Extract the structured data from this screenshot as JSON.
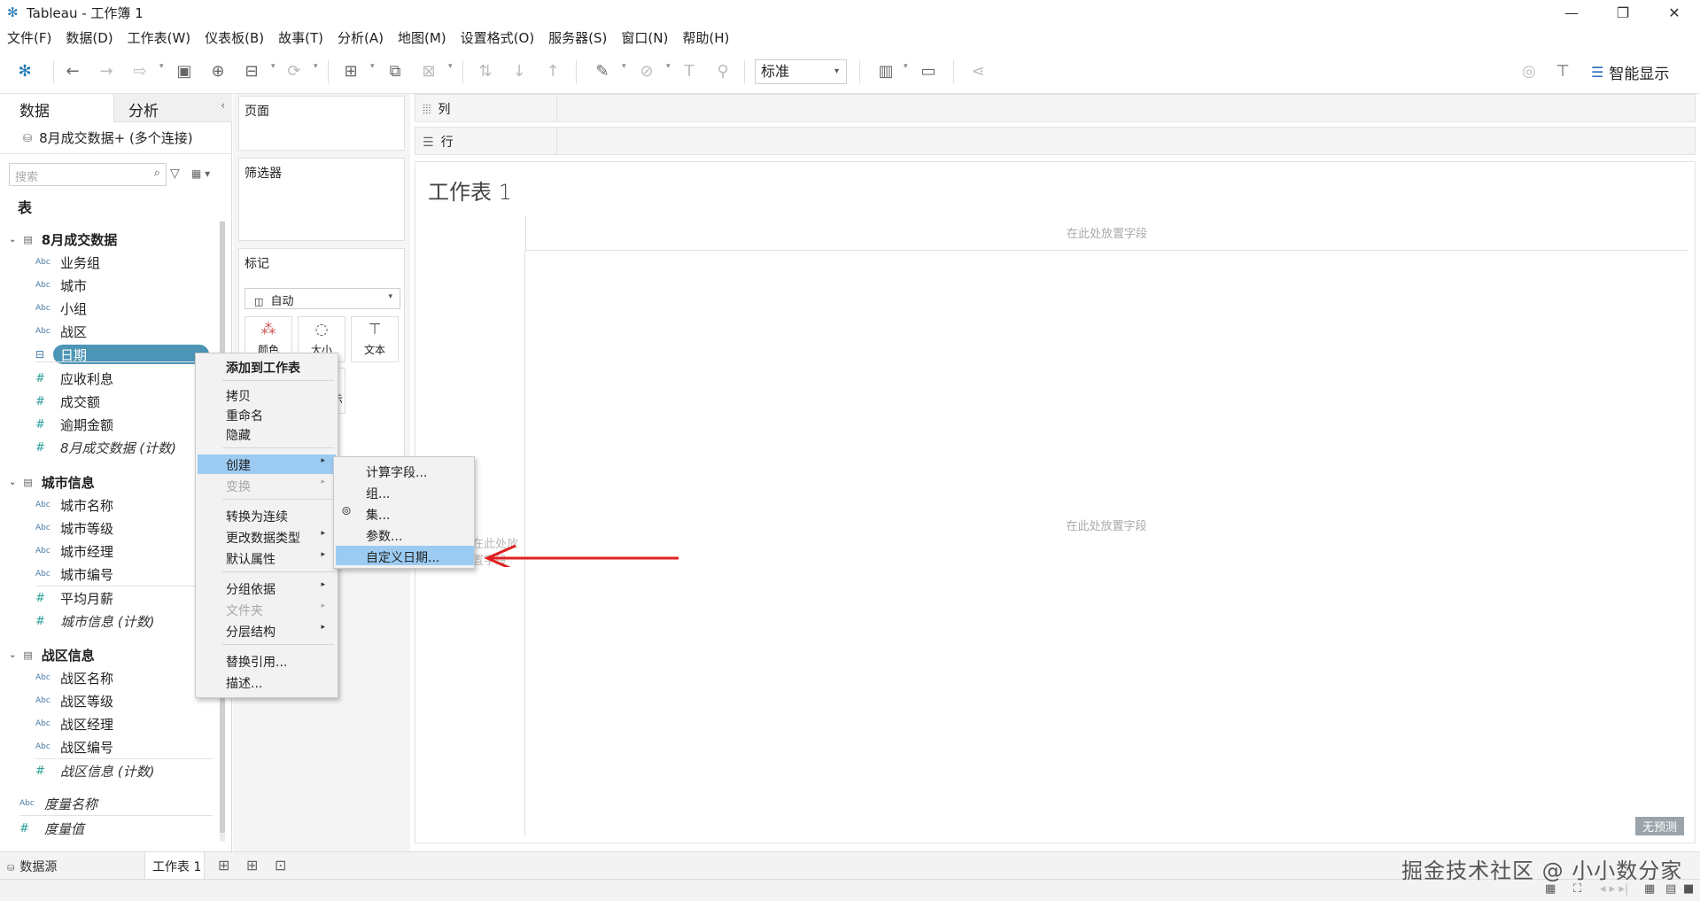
{
  "window": {
    "title": "Tableau - 工作簿 1"
  },
  "menubar": [
    "文件(F)",
    "数据(D)",
    "工作表(W)",
    "仪表板(B)",
    "故事(T)",
    "分析(A)",
    "地图(M)",
    "设置格式(O)",
    "服务器(S)",
    "窗口(N)",
    "帮助(H)"
  ],
  "toolbar": {
    "fit_select": "标准",
    "show_me": "智能显示"
  },
  "datapane": {
    "tab_data": "数据",
    "tab_analysis": "分析",
    "datasource": "8月成交数据+ (多个连接)",
    "search_placeholder": "搜索",
    "tables_label": "表",
    "groups": [
      {
        "name": "8月成交数据"
      },
      {
        "name": "城市信息"
      },
      {
        "name": "战区信息"
      }
    ],
    "fields": {
      "g1": [
        "业务组",
        "城市",
        "小组",
        "战区",
        "日期",
        "应收利息",
        "成交额",
        "逾期金额",
        "8月成交数据 (计数)"
      ],
      "g2": [
        "城市名称",
        "城市等级",
        "城市经理",
        "城市编号",
        "平均月薪",
        "城市信息 (计数)"
      ],
      "g3": [
        "战区名称",
        "战区等级",
        "战区经理",
        "战区编号",
        "战区信息 (计数)"
      ],
      "measure_names": "度量名称",
      "measure_values": "度量值"
    },
    "type_abc": "Abc",
    "type_num": "#"
  },
  "shelves": {
    "pages": "页面",
    "filters": "筛选器",
    "marks": "标记",
    "marks_type": "自动",
    "mark_color": "颜色",
    "mark_size": "大小",
    "mark_text": "文本",
    "mark_detail_tail": "示",
    "columns": "列",
    "rows": "行"
  },
  "view": {
    "title": "工作表 1",
    "drop_field_top": "在此处放置字段",
    "drop_field_left": "在此处放置字段",
    "drop_field_center": "在此处放置字段",
    "no_prediction": "无预测"
  },
  "context_menu": {
    "add_to_sheet": "添加到工作表",
    "copy": "拷贝",
    "rename": "重命名",
    "hide": "隐藏",
    "create": "创建",
    "transform": "变换",
    "convert": "转换为连续",
    "change_type": "更改数据类型",
    "default_props": "默认属性",
    "group_by": "分组依据",
    "folder": "文件夹",
    "hierarchy": "分层结构",
    "replace_ref": "替换引用...",
    "describe": "描述..."
  },
  "submenu": {
    "calc_field": "计算字段...",
    "group": "组...",
    "set": "集...",
    "parameter": "参数...",
    "custom_date": "自定义日期..."
  },
  "bottom": {
    "datasource_tab": "数据源",
    "sheet_tab": "工作表 1"
  },
  "watermark": "掘金技术社区 @ 小小数分家",
  "colors": {
    "selected_field": "#4c95b6",
    "menu_highlight": "#9ccbf2",
    "arrow": "#e02020"
  }
}
